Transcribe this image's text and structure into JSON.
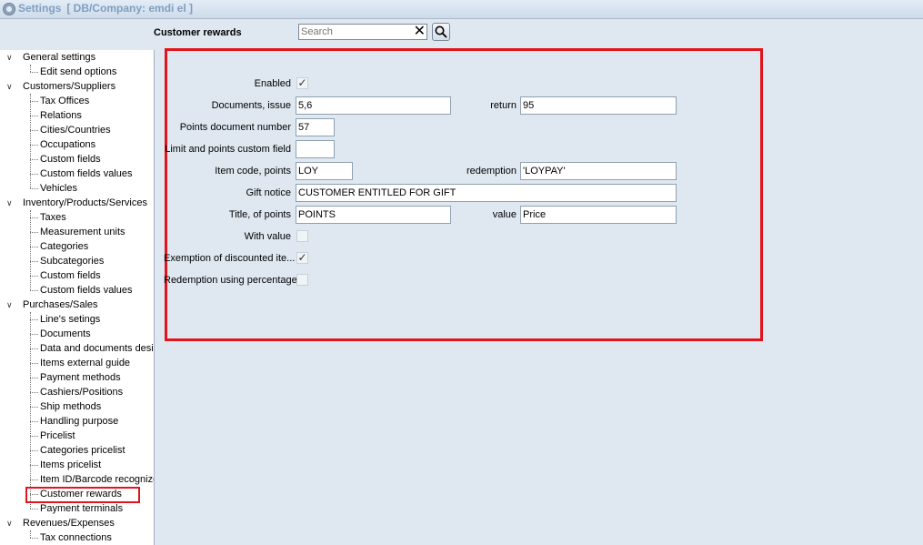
{
  "window": {
    "title": "Settings",
    "db_company": "[ DB/Company: emdi el ]"
  },
  "header": {
    "title": "Customer rewards"
  },
  "search": {
    "placeholder": "Search",
    "value": ""
  },
  "sidebar": {
    "groups": [
      {
        "label": "General settings",
        "items": [
          "Edit send options"
        ]
      },
      {
        "label": "Customers/Suppliers",
        "items": [
          "Tax Offices",
          "Relations",
          "Cities/Countries",
          "Occupations",
          "Custom fields",
          "Custom fields values",
          "Vehicles"
        ]
      },
      {
        "label": "Inventory/Products/Services",
        "items": [
          "Taxes",
          "Measurement units",
          "Categories",
          "Subcategories",
          "Custom fields",
          "Custom fields values"
        ]
      },
      {
        "label": "Purchases/Sales",
        "items": [
          "Line's setings",
          "Documents",
          "Data and documents desi",
          "Items external guide",
          "Payment methods",
          "Cashiers/Positions",
          "Ship methods",
          "Handling purpose",
          "Pricelist",
          "Categories pricelist",
          "Items pricelist",
          "Item ID/Barcode recognize",
          "Customer rewards",
          "Payment terminals"
        ]
      },
      {
        "label": "Revenues/Expenses",
        "items": [
          "Tax connections"
        ]
      }
    ],
    "selected": "Customer rewards"
  },
  "form": {
    "enabled": {
      "label": "Enabled",
      "checked": true
    },
    "documents_issue": {
      "label": "Documents, issue",
      "value": "5,6"
    },
    "return": {
      "label": "return",
      "value": "95"
    },
    "points_document_number": {
      "label": "Points document number",
      "value": "57"
    },
    "limit_points_custom_field": {
      "label": "Limit and points custom field",
      "value": ""
    },
    "item_code_points": {
      "label": "Item code, points",
      "value": "LOY"
    },
    "redemption": {
      "label": "redemption",
      "value": "'LOYPAY'"
    },
    "gift_notice": {
      "label": "Gift notice",
      "value": "CUSTOMER ENTITLED FOR GIFT"
    },
    "title_of_points": {
      "label": "Title, of points",
      "value": "POINTS"
    },
    "value": {
      "label": "value",
      "value": "Price"
    },
    "with_value": {
      "label": "With value",
      "checked": false
    },
    "exemption_discounted": {
      "label": "Exemption of discounted ite...",
      "checked": true
    },
    "redemption_percentage": {
      "label": "Redemption using percentage",
      "checked": false
    }
  },
  "colors": {
    "highlight": "#e2141c",
    "title": "#7f9fbf",
    "background": "#dfe8f1"
  }
}
